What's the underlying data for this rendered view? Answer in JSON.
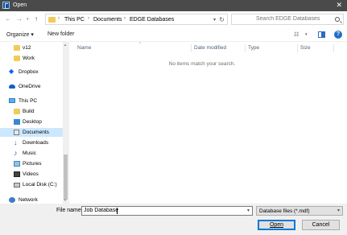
{
  "window": {
    "title": "Open",
    "close_glyph": "✕"
  },
  "nav": {
    "back": "←",
    "forward": "→",
    "recent": "▾",
    "up": "↑"
  },
  "address": {
    "parts": [
      "This PC",
      "Documents",
      "EDGE Databases"
    ],
    "separator": "›",
    "dropdown": "▾",
    "refresh": "↻"
  },
  "search": {
    "placeholder": "Search EDGE Databases"
  },
  "toolbar": {
    "organize": "Organize ▾",
    "new_folder": "New folder",
    "view_glyph": "☷",
    "view_dropdown": "▾",
    "help": "?"
  },
  "sidebar": {
    "items": [
      {
        "label": "v12",
        "icon": "folder-icon"
      },
      {
        "label": "Work",
        "icon": "folder-icon"
      },
      {
        "label": "Dropbox",
        "icon": "dropbox-icon"
      },
      {
        "label": "OneDrive",
        "icon": "onedrive-icon"
      },
      {
        "label": "This PC",
        "icon": "this-pc-icon"
      },
      {
        "label": "Build",
        "icon": "folder-icon"
      },
      {
        "label": "Desktop",
        "icon": "desktop-icon"
      },
      {
        "label": "Documents",
        "icon": "documents-icon"
      },
      {
        "label": "Downloads",
        "icon": "downloads-icon"
      },
      {
        "label": "Music",
        "icon": "music-icon"
      },
      {
        "label": "Pictures",
        "icon": "pictures-icon"
      },
      {
        "label": "Videos",
        "icon": "videos-icon"
      },
      {
        "label": "Local Disk (C:)",
        "icon": "local-disk-icon"
      },
      {
        "label": "Network",
        "icon": "network-icon"
      }
    ],
    "selected": "Documents",
    "scroll_up": "▲",
    "scroll_down": "▼"
  },
  "filelist": {
    "columns": [
      "Name",
      "Date modified",
      "Type",
      "Size"
    ],
    "sort_glyph": "^",
    "empty_message": "No items match your search."
  },
  "footer": {
    "file_name_label": "File name:",
    "file_name_value": "Job Database",
    "file_name_dropdown": "▾",
    "file_type": "Database files (*.mdf)",
    "file_type_dropdown": "▾",
    "open_button": "Open",
    "cancel_button": "Cancel"
  },
  "colors": {
    "titlebar": "#4a4a4a",
    "selection": "#cce8ff",
    "accent": "#0078d7"
  }
}
